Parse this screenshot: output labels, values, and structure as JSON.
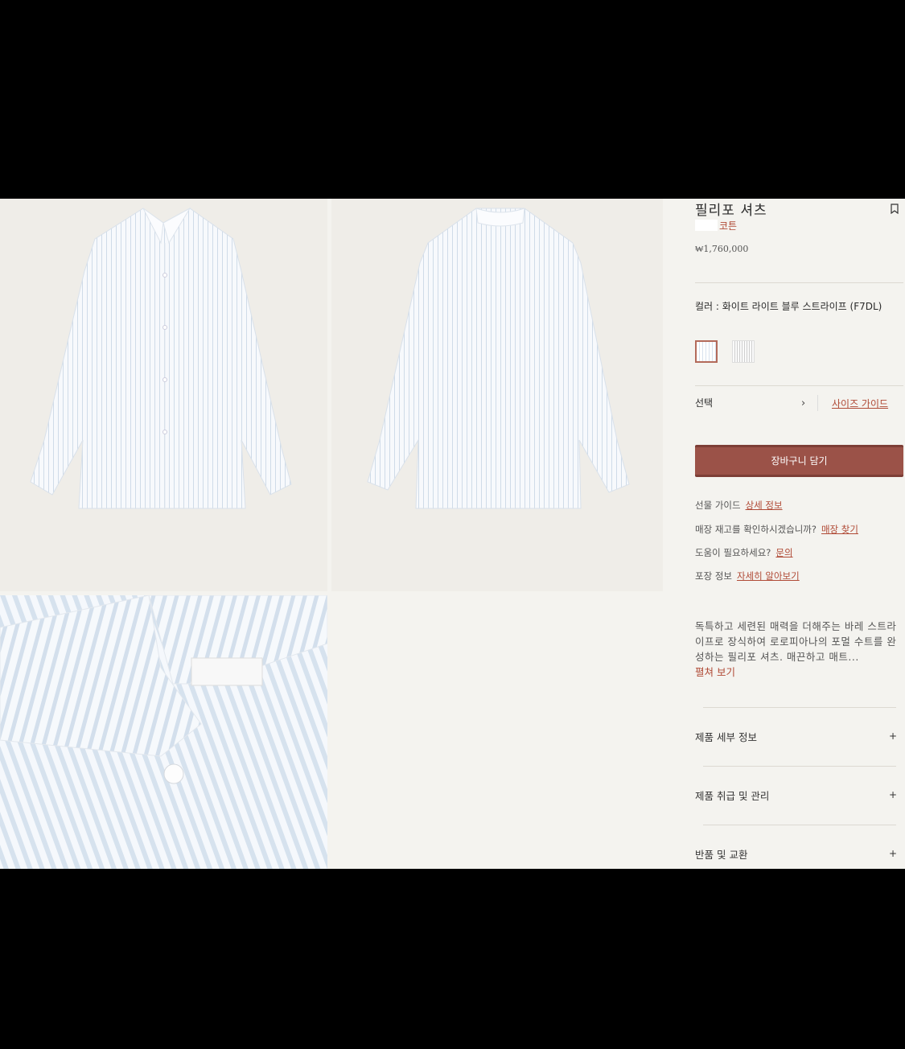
{
  "product": {
    "title": "필리포 셔츠",
    "material": "코튼",
    "price": "₩1,760,000",
    "color_label": "컬러 : 화이트 라이트 블루 스트라이프 (F7DL)"
  },
  "selection": {
    "select_label": "선택",
    "size_guide": "사이즈 가이드"
  },
  "cart_button": "장바구니 담기",
  "info_rows": [
    {
      "label": "선물 가이드",
      "link": "상세 정보"
    },
    {
      "label": "매장 재고를 확인하시겠습니까?",
      "link": "매장 찾기"
    },
    {
      "label": "도움이 필요하세요?",
      "link": "문의"
    },
    {
      "label": "포장 정보",
      "link": "자세히 알아보기"
    }
  ],
  "description": "독특하고 세련된 매력을 더해주는 바레 스트라이프로 장식하여 로로피아나의 포멀 수트를 완성하는 필리포 셔츠. 매끈하고 매트...",
  "read_more": "펼쳐 보기",
  "accordion": [
    {
      "label": "제품 세부 정보",
      "icon": "+"
    },
    {
      "label": "제품 취급 및 관리",
      "icon": "+"
    },
    {
      "label": "반품 및 교환",
      "icon": "+"
    }
  ],
  "icons": {
    "bookmark": "bookmark-icon",
    "chevron": "chevron-right-icon",
    "plus": "plus-icon"
  },
  "colors": {
    "accent": "#9b5248",
    "link": "#b04a36",
    "background": "#f4f3ef"
  }
}
